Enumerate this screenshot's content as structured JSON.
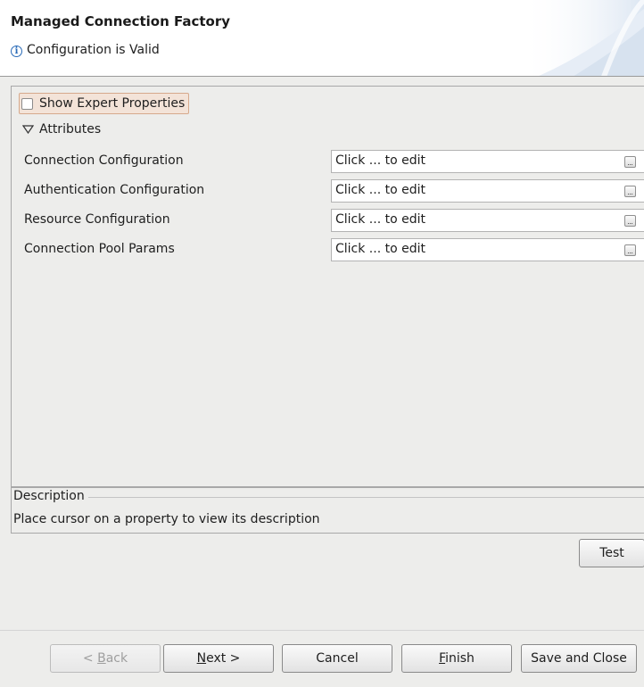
{
  "header": {
    "title": "Managed Connection Factory",
    "status_text": "Configuration is Valid",
    "status_icon": "info-icon"
  },
  "properties": {
    "show_expert_label": "Show Expert Properties",
    "show_expert_checked": false,
    "section_label": "Attributes",
    "rows": [
      {
        "label": "Connection Configuration",
        "value": "Click ... to edit"
      },
      {
        "label": "Authentication Configuration",
        "value": "Click ... to edit"
      },
      {
        "label": "Resource Configuration",
        "value": "Click ... to edit"
      },
      {
        "label": "Connection Pool Params",
        "value": "Click ... to edit"
      }
    ]
  },
  "description": {
    "title": "Description",
    "text": "Place cursor on a property to view its description"
  },
  "buttons": {
    "test": "Test",
    "back_prefix": "< ",
    "back_mnemonic": "B",
    "back_rest": "ack",
    "next_mnemonic": "N",
    "next_rest": "ext >",
    "cancel": "Cancel",
    "finish_mnemonic": "F",
    "finish_rest": "inish",
    "save_close": "Save and Close"
  },
  "colors": {
    "expert_highlight": "#f3e3d8",
    "info_blue": "#2a6bb8",
    "background": "#ededeb"
  }
}
